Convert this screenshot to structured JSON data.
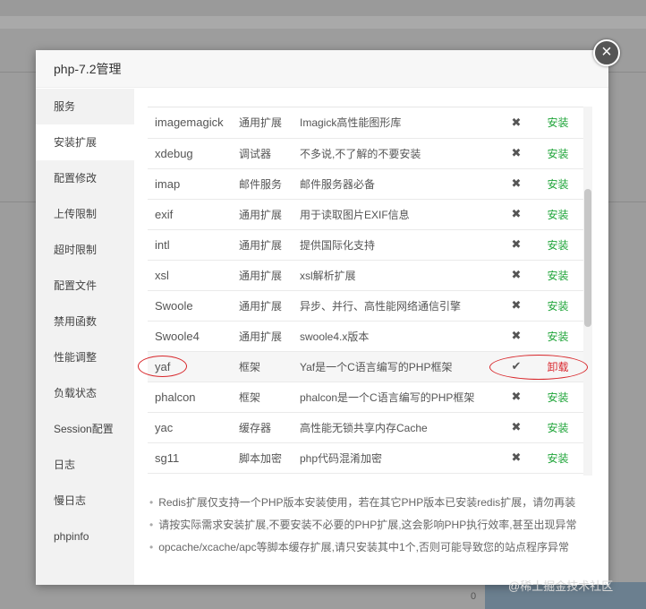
{
  "dialog": {
    "title": "php-7.2管理",
    "close_label": "×"
  },
  "sidebar": {
    "active_index": 1,
    "items": [
      {
        "label": "服务"
      },
      {
        "label": "安装扩展"
      },
      {
        "label": "配置修改"
      },
      {
        "label": "上传限制"
      },
      {
        "label": "超时限制"
      },
      {
        "label": "配置文件"
      },
      {
        "label": "禁用函数"
      },
      {
        "label": "性能调整"
      },
      {
        "label": "负载状态"
      },
      {
        "label": "Session配置"
      },
      {
        "label": "日志"
      },
      {
        "label": "慢日志"
      },
      {
        "label": "phpinfo"
      }
    ]
  },
  "extensions": [
    {
      "name": "imagemagick",
      "type": "通用扩展",
      "desc": "Imagick高性能图形库",
      "status_icon": "✖",
      "status_icon_name": "not-installed-icon",
      "action": "安装"
    },
    {
      "name": "xdebug",
      "type": "调试器",
      "desc": "不多说,不了解的不要安装",
      "status_icon": "✖",
      "status_icon_name": "not-installed-icon",
      "action": "安装"
    },
    {
      "name": "imap",
      "type": "邮件服务",
      "desc": "邮件服务器必备",
      "status_icon": "✖",
      "status_icon_name": "not-installed-icon",
      "action": "安装"
    },
    {
      "name": "exif",
      "type": "通用扩展",
      "desc": "用于读取图片EXIF信息",
      "status_icon": "✖",
      "status_icon_name": "not-installed-icon",
      "action": "安装"
    },
    {
      "name": "intl",
      "type": "通用扩展",
      "desc": "提供国际化支持",
      "status_icon": "✖",
      "status_icon_name": "not-installed-icon",
      "action": "安装"
    },
    {
      "name": "xsl",
      "type": "通用扩展",
      "desc": "xsl解析扩展",
      "status_icon": "✖",
      "status_icon_name": "not-installed-icon",
      "action": "安装"
    },
    {
      "name": "Swoole",
      "type": "通用扩展",
      "desc": "异步、并行、高性能网络通信引擎",
      "status_icon": "✖",
      "status_icon_name": "not-installed-icon",
      "action": "安装"
    },
    {
      "name": "Swoole4",
      "type": "通用扩展",
      "desc": "swoole4.x版本",
      "status_icon": "✖",
      "status_icon_name": "not-installed-icon",
      "action": "安装"
    },
    {
      "name": "yaf",
      "type": "框架",
      "desc": "Yaf是一个C语言编写的PHP框架",
      "status_icon": "✔",
      "status_icon_name": "installed-check-icon",
      "action": "卸载",
      "installed": true
    },
    {
      "name": "phalcon",
      "type": "框架",
      "desc": "phalcon是一个C语言编写的PHP框架",
      "status_icon": "✖",
      "status_icon_name": "not-installed-icon",
      "action": "安装"
    },
    {
      "name": "yac",
      "type": "缓存器",
      "desc": "高性能无锁共享内存Cache",
      "status_icon": "✖",
      "status_icon_name": "not-installed-icon",
      "action": "安装"
    },
    {
      "name": "sg11",
      "type": "脚本加密",
      "desc": "php代码混淆加密",
      "status_icon": "✖",
      "status_icon_name": "not-installed-icon",
      "action": "安装"
    }
  ],
  "notes": [
    "Redis扩展仅支持一个PHP版本安装使用，若在其它PHP版本已安装redis扩展，请勿再装",
    "请按实际需求安装扩展,不要安装不必要的PHP扩展,这会影响PHP执行效率,甚至出现异常",
    "opcache/xcache/apc等脚本缓存扩展,请只安装其中1个,否则可能导致您的站点程序异常"
  ],
  "background": {
    "zero_text": "0"
  },
  "watermark": "@稀土掘金技术社区",
  "colors": {
    "install": "#20a53a",
    "uninstall": "#d9262d",
    "annotation": "#d8262a"
  }
}
